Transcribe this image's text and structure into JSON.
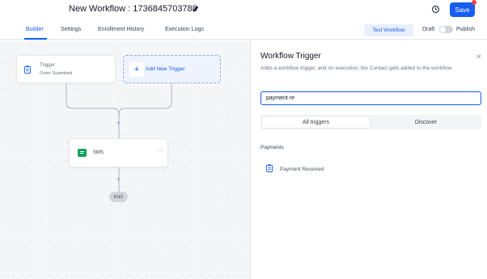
{
  "header": {
    "workflow_title": "New Workflow : 1736845703788",
    "save_label": "Save"
  },
  "tabs": [
    {
      "label": "Builder"
    },
    {
      "label": "Settings"
    },
    {
      "label": "Enrollment History"
    },
    {
      "label": "Execution Logs"
    }
  ],
  "toolbar": {
    "test_label": "Test Workflow",
    "draft_label": "Draft",
    "publish_label": "Publish"
  },
  "canvas": {
    "trigger_card": {
      "title": "Trigger",
      "subtitle": "Order Submitted"
    },
    "add_trigger_label": "Add New Trigger",
    "plus_symbol": "+",
    "action_card": {
      "label": "SMS",
      "menu": "···"
    },
    "end_label": "END"
  },
  "panel": {
    "title": "Workflow Trigger",
    "close_symbol": "✕",
    "description": "Adds a workflow trigger, and on execution, the Contact gets added to the workflow.",
    "search_value": "payment re",
    "segment": {
      "all": "All triggers",
      "discover": "Discover"
    },
    "section_label": "Payments",
    "results": [
      {
        "label": "Payment Received"
      }
    ]
  },
  "colors": {
    "accent": "#155eef",
    "sms_green": "#12a15a",
    "notification_red": "#ef4444"
  }
}
